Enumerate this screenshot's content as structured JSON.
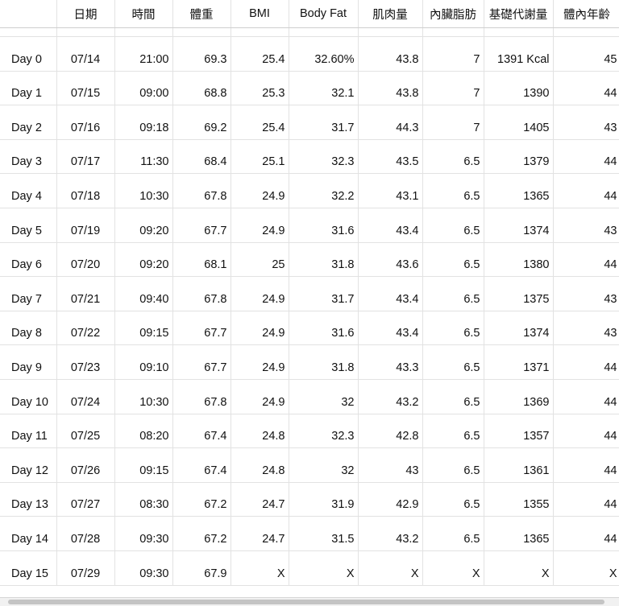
{
  "headers": [
    "",
    "日期",
    "時間",
    "體重",
    "BMI",
    "Body Fat",
    "肌肉量",
    "內臟脂肪",
    "基礎代謝量",
    "體內年齡"
  ],
  "rows": [
    [
      "Day 0",
      "07/14",
      "21:00",
      "69.3",
      "25.4",
      "32.60%",
      "43.8",
      "7",
      "1391 Kcal",
      "45"
    ],
    [
      "Day 1",
      "07/15",
      "09:00",
      "68.8",
      "25.3",
      "32.1",
      "43.8",
      "7",
      "1390",
      "44"
    ],
    [
      "Day 2",
      "07/16",
      "09:18",
      "69.2",
      "25.4",
      "31.7",
      "44.3",
      "7",
      "1405",
      "43"
    ],
    [
      "Day 3",
      "07/17",
      "11:30",
      "68.4",
      "25.1",
      "32.3",
      "43.5",
      "6.5",
      "1379",
      "44"
    ],
    [
      "Day 4",
      "07/18",
      "10:30",
      "67.8",
      "24.9",
      "32.2",
      "43.1",
      "6.5",
      "1365",
      "44"
    ],
    [
      "Day 5",
      "07/19",
      "09:20",
      "67.7",
      "24.9",
      "31.6",
      "43.4",
      "6.5",
      "1374",
      "43"
    ],
    [
      "Day 6",
      "07/20",
      "09:20",
      "68.1",
      "25",
      "31.8",
      "43.6",
      "6.5",
      "1380",
      "44"
    ],
    [
      "Day 7",
      "07/21",
      "09:40",
      "67.8",
      "24.9",
      "31.7",
      "43.4",
      "6.5",
      "1375",
      "43"
    ],
    [
      "Day 8",
      "07/22",
      "09:15",
      "67.7",
      "24.9",
      "31.6",
      "43.4",
      "6.5",
      "1374",
      "43"
    ],
    [
      "Day 9",
      "07/23",
      "09:10",
      "67.7",
      "24.9",
      "31.8",
      "43.3",
      "6.5",
      "1371",
      "44"
    ],
    [
      "Day 10",
      "07/24",
      "10:30",
      "67.8",
      "24.9",
      "32",
      "43.2",
      "6.5",
      "1369",
      "44"
    ],
    [
      "Day 11",
      "07/25",
      "08:20",
      "67.4",
      "24.8",
      "32.3",
      "42.8",
      "6.5",
      "1357",
      "44"
    ],
    [
      "Day 12",
      "07/26",
      "09:15",
      "67.4",
      "24.8",
      "32",
      "43",
      "6.5",
      "1361",
      "44"
    ],
    [
      "Day 13",
      "07/27",
      "08:30",
      "67.2",
      "24.7",
      "31.9",
      "42.9",
      "6.5",
      "1355",
      "44"
    ],
    [
      "Day 14",
      "07/28",
      "09:30",
      "67.2",
      "24.7",
      "31.5",
      "43.2",
      "6.5",
      "1365",
      "44"
    ],
    [
      "Day 15",
      "07/29",
      "09:30",
      "67.9",
      "X",
      "X",
      "X",
      "X",
      "X",
      "X"
    ]
  ]
}
